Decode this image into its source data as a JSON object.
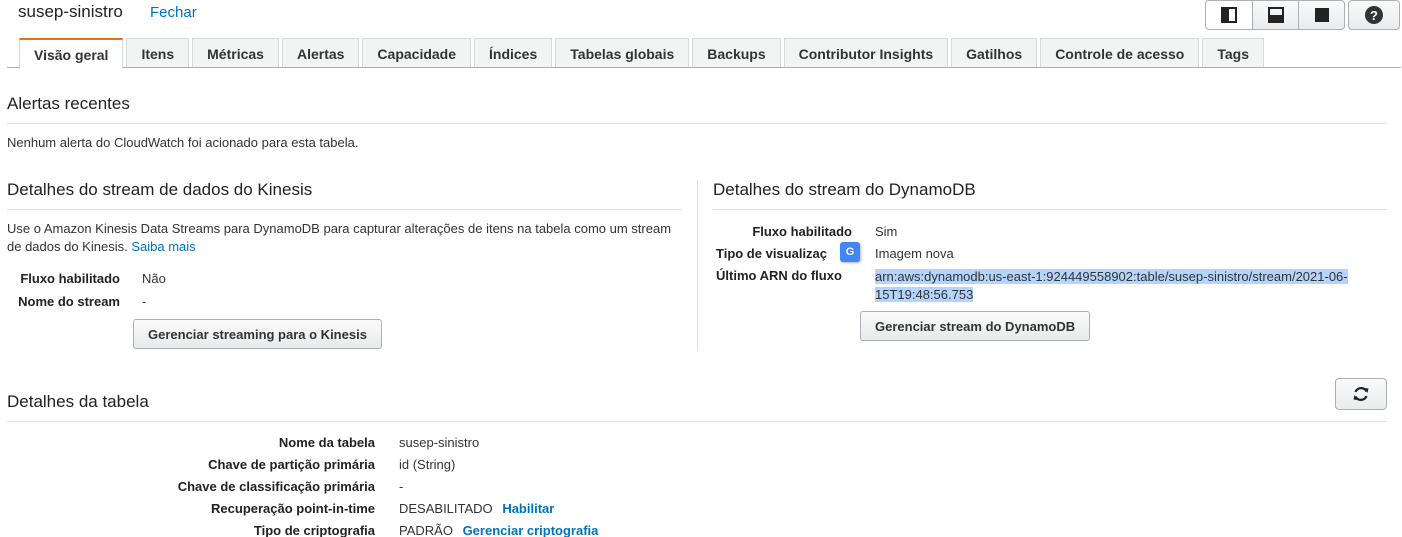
{
  "header": {
    "table_name": "susep-sinistro",
    "close_label": "Fechar",
    "help_label": "?"
  },
  "tabs": [
    {
      "label": "Visão geral",
      "active": true
    },
    {
      "label": "Itens"
    },
    {
      "label": "Métricas"
    },
    {
      "label": "Alertas"
    },
    {
      "label": "Capacidade"
    },
    {
      "label": "Índices"
    },
    {
      "label": "Tabelas globais"
    },
    {
      "label": "Backups"
    },
    {
      "label": "Contributor Insights"
    },
    {
      "label": "Gatilhos"
    },
    {
      "label": "Controle de acesso"
    },
    {
      "label": "Tags"
    }
  ],
  "alerts": {
    "title": "Alertas recentes",
    "message": "Nenhum alerta do CloudWatch foi acionado para esta tabela."
  },
  "kinesis": {
    "title": "Detalhes do stream de dados do Kinesis",
    "description": "Use o Amazon Kinesis Data Streams para DynamoDB para capturar alterações de itens na tabela como um stream de dados do Kinesis.",
    "learn_more": "Saiba mais",
    "fields": [
      {
        "label": "Fluxo habilitado",
        "value": "Não"
      },
      {
        "label": "Nome do stream",
        "value": "-"
      }
    ],
    "manage_button": "Gerenciar streaming para o Kinesis"
  },
  "dynamodb_stream": {
    "title": "Detalhes do stream do DynamoDB",
    "fields": [
      {
        "label": "Fluxo habilitado",
        "value": "Sim"
      },
      {
        "label": "Tipo de visualizaç",
        "value": "Imagem nova"
      },
      {
        "label": "Último ARN do fluxo",
        "value": "arn:aws:dynamodb:us-east-1:924449558902:table/susep-sinistro/stream/2021-06-15T19:48:56.753"
      }
    ],
    "manage_button": "Gerenciar stream do DynamoDB"
  },
  "table_details": {
    "title": "Detalhes da tabela",
    "fields": [
      {
        "label": "Nome da tabela",
        "value": "susep-sinistro"
      },
      {
        "label": "Chave de partição primária",
        "value": "id (String)"
      },
      {
        "label": "Chave de classificação primária",
        "value": "-"
      },
      {
        "label": "Recuperação point-in-time",
        "value": "DESABILITADO",
        "link": "Habilitar"
      },
      {
        "label": "Tipo de criptografia",
        "value": "PADRÃO",
        "link": "Gerenciar criptografia"
      }
    ]
  },
  "colors": {
    "accent": "#ec7211",
    "link": "#0073bb",
    "selection": "#b3d4fc"
  }
}
